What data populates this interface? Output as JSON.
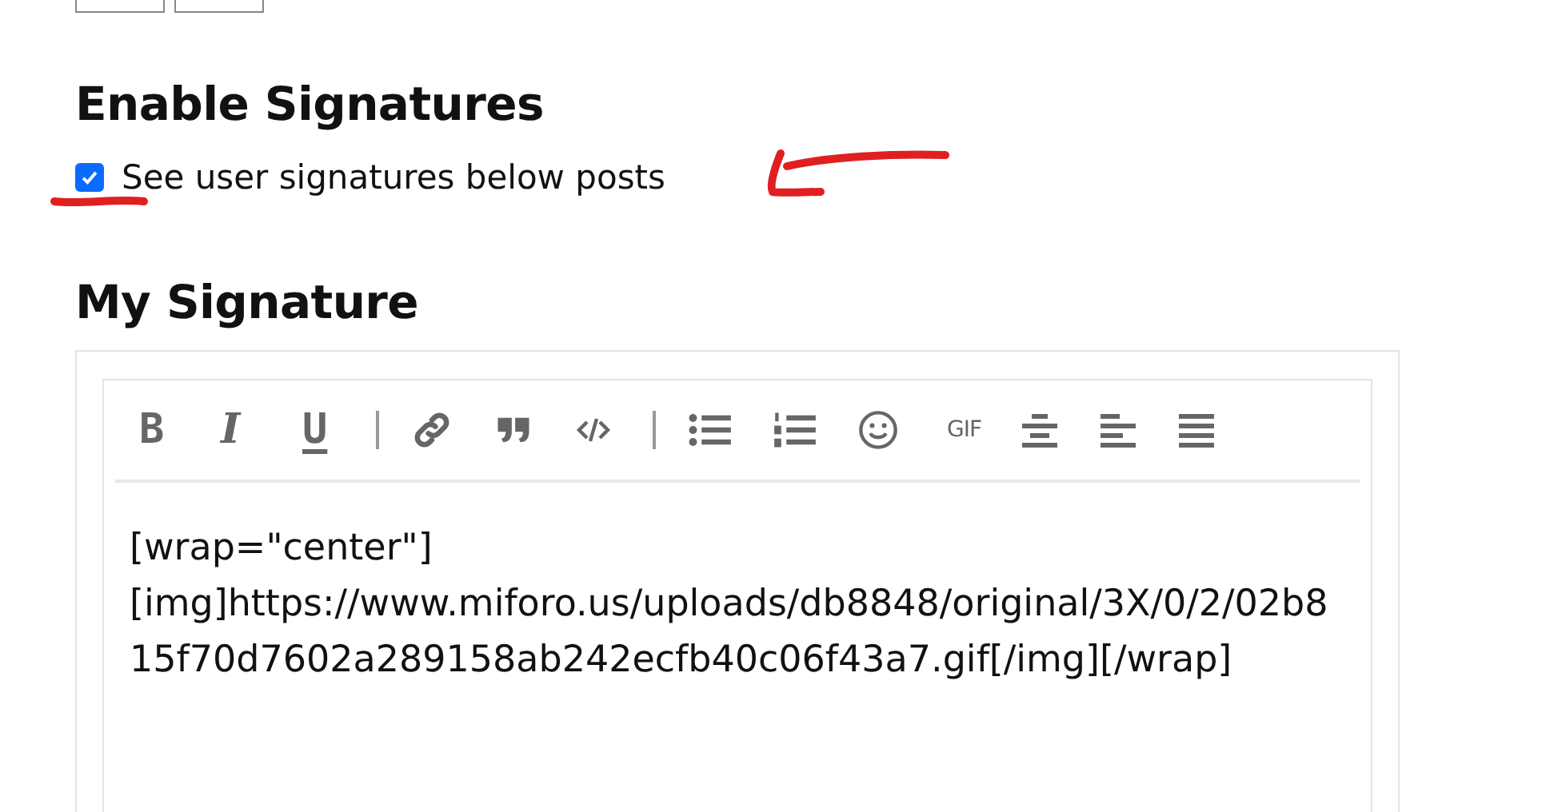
{
  "top_buttons": [
    {
      "kind": "blank"
    },
    {
      "kind": "blank"
    }
  ],
  "enable_signatures": {
    "heading": "Enable Signatures",
    "checkbox": {
      "label": "See user signatures below posts",
      "checked": true
    }
  },
  "my_signature": {
    "heading": "My Signature",
    "toolbar": [
      {
        "kind": "bold",
        "text": "B"
      },
      {
        "kind": "italic",
        "text": "I"
      },
      {
        "kind": "underline",
        "text": "U"
      },
      {
        "kind": "separator"
      },
      {
        "kind": "link"
      },
      {
        "kind": "quote"
      },
      {
        "kind": "code"
      },
      {
        "kind": "separator"
      },
      {
        "kind": "bullet-list"
      },
      {
        "kind": "numbered-list"
      },
      {
        "kind": "emoji"
      },
      {
        "kind": "gif",
        "text": "GIF"
      },
      {
        "kind": "align-center"
      },
      {
        "kind": "align-left"
      },
      {
        "kind": "align-justify"
      }
    ],
    "value": "[wrap=\"center\"]\n[img]https://www.miforo.us/uploads/db8848/original/3X/0/2/02b815f70d7602a289158ab242ecfb40c06f43a7.gif[/img][/wrap]"
  },
  "annotations": {
    "arrow": true,
    "underline": true
  }
}
